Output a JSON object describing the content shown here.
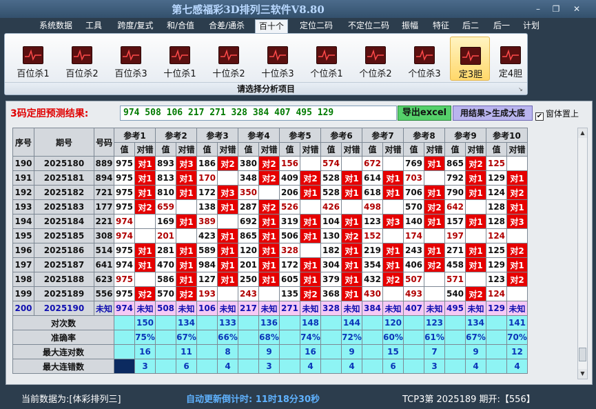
{
  "app": {
    "title": "第七感福彩3D排列三软件V8.80"
  },
  "menu": [
    "系统数据",
    "工具",
    "跨度/复式",
    "和/合值",
    "合差/通杀",
    "百十个",
    "定位二码",
    "不定位二码",
    "振幅",
    "特征",
    "后二",
    "后一",
    "计划"
  ],
  "menu_active": "百十个",
  "ribbon": {
    "buttons": [
      "百位杀1",
      "百位杀2",
      "百位杀3",
      "十位杀1",
      "十位杀2",
      "十位杀3",
      "个位杀1",
      "个位杀2",
      "个位杀3",
      "定3胆",
      "定4胆"
    ],
    "selected": "定3胆",
    "caption": "请选择分析项目"
  },
  "prediction": {
    "label": "3码定胆预测结果:",
    "value": "974 508 106 217 271 328 384 407 495 129",
    "export_label": "导出excel",
    "generate_label": "用结果>生成大底",
    "topmost_label": "窗体置上",
    "topmost_checked": "✔"
  },
  "table": {
    "col_seq": "序号",
    "col_period": "期号",
    "col_number": "号码",
    "ref_labels": [
      "参考1",
      "参考2",
      "参考3",
      "参考4",
      "参考5",
      "参考6",
      "参考7",
      "参考8",
      "参考9",
      "参考10"
    ],
    "sub_value": "值",
    "sub_hit": "对错",
    "rows": [
      {
        "seq": "190",
        "period": "2025180",
        "num": "889",
        "refs": [
          [
            "975",
            "对1"
          ],
          [
            "893",
            "对3"
          ],
          [
            "186",
            "对2"
          ],
          [
            "380",
            "对2"
          ],
          [
            "156",
            ""
          ],
          [
            "574",
            ""
          ],
          [
            "672",
            ""
          ],
          [
            "769",
            "对1"
          ],
          [
            "865",
            "对2"
          ],
          [
            "125",
            ""
          ]
        ]
      },
      {
        "seq": "191",
        "period": "2025181",
        "num": "894",
        "refs": [
          [
            "975",
            "对1"
          ],
          [
            "813",
            "对1"
          ],
          [
            "170",
            ""
          ],
          [
            "348",
            "对2"
          ],
          [
            "409",
            "对2"
          ],
          [
            "528",
            "对1"
          ],
          [
            "614",
            "对1"
          ],
          [
            "703",
            ""
          ],
          [
            "792",
            "对1"
          ],
          [
            "129",
            "对1"
          ]
        ]
      },
      {
        "seq": "192",
        "period": "2025182",
        "num": "721",
        "refs": [
          [
            "975",
            "对1"
          ],
          [
            "810",
            "对1"
          ],
          [
            "172",
            "对3"
          ],
          [
            "350",
            ""
          ],
          [
            "206",
            "对1"
          ],
          [
            "528",
            "对1"
          ],
          [
            "618",
            "对1"
          ],
          [
            "706",
            "对1"
          ],
          [
            "790",
            "对1"
          ],
          [
            "124",
            "对2"
          ]
        ]
      },
      {
        "seq": "193",
        "period": "2025183",
        "num": "177",
        "refs": [
          [
            "975",
            "对2"
          ],
          [
            "659",
            ""
          ],
          [
            "138",
            "对1"
          ],
          [
            "287",
            "对2"
          ],
          [
            "526",
            ""
          ],
          [
            "426",
            ""
          ],
          [
            "498",
            ""
          ],
          [
            "570",
            "对2"
          ],
          [
            "642",
            ""
          ],
          [
            "128",
            "对1"
          ]
        ]
      },
      {
        "seq": "194",
        "period": "2025184",
        "num": "221",
        "refs": [
          [
            "974",
            ""
          ],
          [
            "169",
            "对1"
          ],
          [
            "389",
            ""
          ],
          [
            "692",
            "对1"
          ],
          [
            "319",
            "对1"
          ],
          [
            "104",
            "对1"
          ],
          [
            "123",
            "对3"
          ],
          [
            "140",
            "对1"
          ],
          [
            "157",
            "对1"
          ],
          [
            "128",
            "对3"
          ]
        ]
      },
      {
        "seq": "195",
        "period": "2025185",
        "num": "308",
        "refs": [
          [
            "974",
            ""
          ],
          [
            "201",
            ""
          ],
          [
            "423",
            "对1"
          ],
          [
            "865",
            "对1"
          ],
          [
            "506",
            "对1"
          ],
          [
            "130",
            "对2"
          ],
          [
            "152",
            ""
          ],
          [
            "174",
            ""
          ],
          [
            "197",
            ""
          ],
          [
            "124",
            ""
          ]
        ]
      },
      {
        "seq": "196",
        "period": "2025186",
        "num": "514",
        "refs": [
          [
            "975",
            "对1"
          ],
          [
            "281",
            "对1"
          ],
          [
            "589",
            "对1"
          ],
          [
            "120",
            "对1"
          ],
          [
            "328",
            ""
          ],
          [
            "182",
            "对1"
          ],
          [
            "219",
            "对1"
          ],
          [
            "243",
            "对1"
          ],
          [
            "271",
            "对1"
          ],
          [
            "125",
            "对2"
          ]
        ]
      },
      {
        "seq": "197",
        "period": "2025187",
        "num": "641",
        "refs": [
          [
            "974",
            "对1"
          ],
          [
            "470",
            "对1"
          ],
          [
            "984",
            "对1"
          ],
          [
            "201",
            "对1"
          ],
          [
            "172",
            "对1"
          ],
          [
            "304",
            "对1"
          ],
          [
            "354",
            "对1"
          ],
          [
            "406",
            "对2"
          ],
          [
            "458",
            "对1"
          ],
          [
            "129",
            "对1"
          ]
        ]
      },
      {
        "seq": "198",
        "period": "2025188",
        "num": "623",
        "refs": [
          [
            "975",
            ""
          ],
          [
            "586",
            "对1"
          ],
          [
            "127",
            "对1"
          ],
          [
            "250",
            "对1"
          ],
          [
            "605",
            "对1"
          ],
          [
            "379",
            "对1"
          ],
          [
            "432",
            "对2"
          ],
          [
            "507",
            ""
          ],
          [
            "571",
            ""
          ],
          [
            "123",
            "对2"
          ]
        ]
      },
      {
        "seq": "199",
        "period": "2025189",
        "num": "556",
        "refs": [
          [
            "975",
            "对2"
          ],
          [
            "570",
            "对2"
          ],
          [
            "193",
            ""
          ],
          [
            "243",
            ""
          ],
          [
            "135",
            "对2"
          ],
          [
            "368",
            "对1"
          ],
          [
            "430",
            ""
          ],
          [
            "493",
            ""
          ],
          [
            "540",
            "对2"
          ],
          [
            "124",
            ""
          ]
        ]
      }
    ],
    "unknown_row": {
      "seq": "200",
      "period": "2025190",
      "num": "未知",
      "refs": [
        [
          "974",
          "未知"
        ],
        [
          "508",
          "未知"
        ],
        [
          "106",
          "未知"
        ],
        [
          "217",
          "未知"
        ],
        [
          "271",
          "未知"
        ],
        [
          "328",
          "未知"
        ],
        [
          "384",
          "未知"
        ],
        [
          "407",
          "未知"
        ],
        [
          "495",
          "未知"
        ],
        [
          "129",
          "未知"
        ]
      ]
    },
    "stats": [
      {
        "label": "对次数",
        "values": [
          "150",
          "134",
          "133",
          "136",
          "148",
          "144",
          "120",
          "123",
          "134",
          "141"
        ]
      },
      {
        "label": "准确率",
        "values": [
          "75%",
          "67%",
          "66%",
          "68%",
          "74%",
          "72%",
          "60%",
          "61%",
          "67%",
          "70%"
        ]
      },
      {
        "label": "最大连对数",
        "values": [
          "16",
          "11",
          "8",
          "9",
          "16",
          "9",
          "15",
          "7",
          "9",
          "12"
        ]
      },
      {
        "label": "最大连错数",
        "values": [
          "3",
          "6",
          "4",
          "3",
          "4",
          "4",
          "6",
          "3",
          "4",
          "4"
        ]
      }
    ]
  },
  "status": {
    "source": "当前数据为:[体彩排列三]",
    "timer": "自动更新倒计时:  11时18分30秒",
    "period": "TCP3第 2025189 期开:【556】"
  },
  "colors": {
    "hit_bg": "#e60000",
    "miss_text": "#b00000",
    "unknown_bg": "#f5c9f5",
    "stat_bg": "#8ef4f4",
    "stat_text": "#0b36b8"
  },
  "icons": {
    "ribbon": "chart-icon",
    "minimize": "minimize-icon",
    "restore": "restore-icon",
    "close": "close-icon"
  }
}
